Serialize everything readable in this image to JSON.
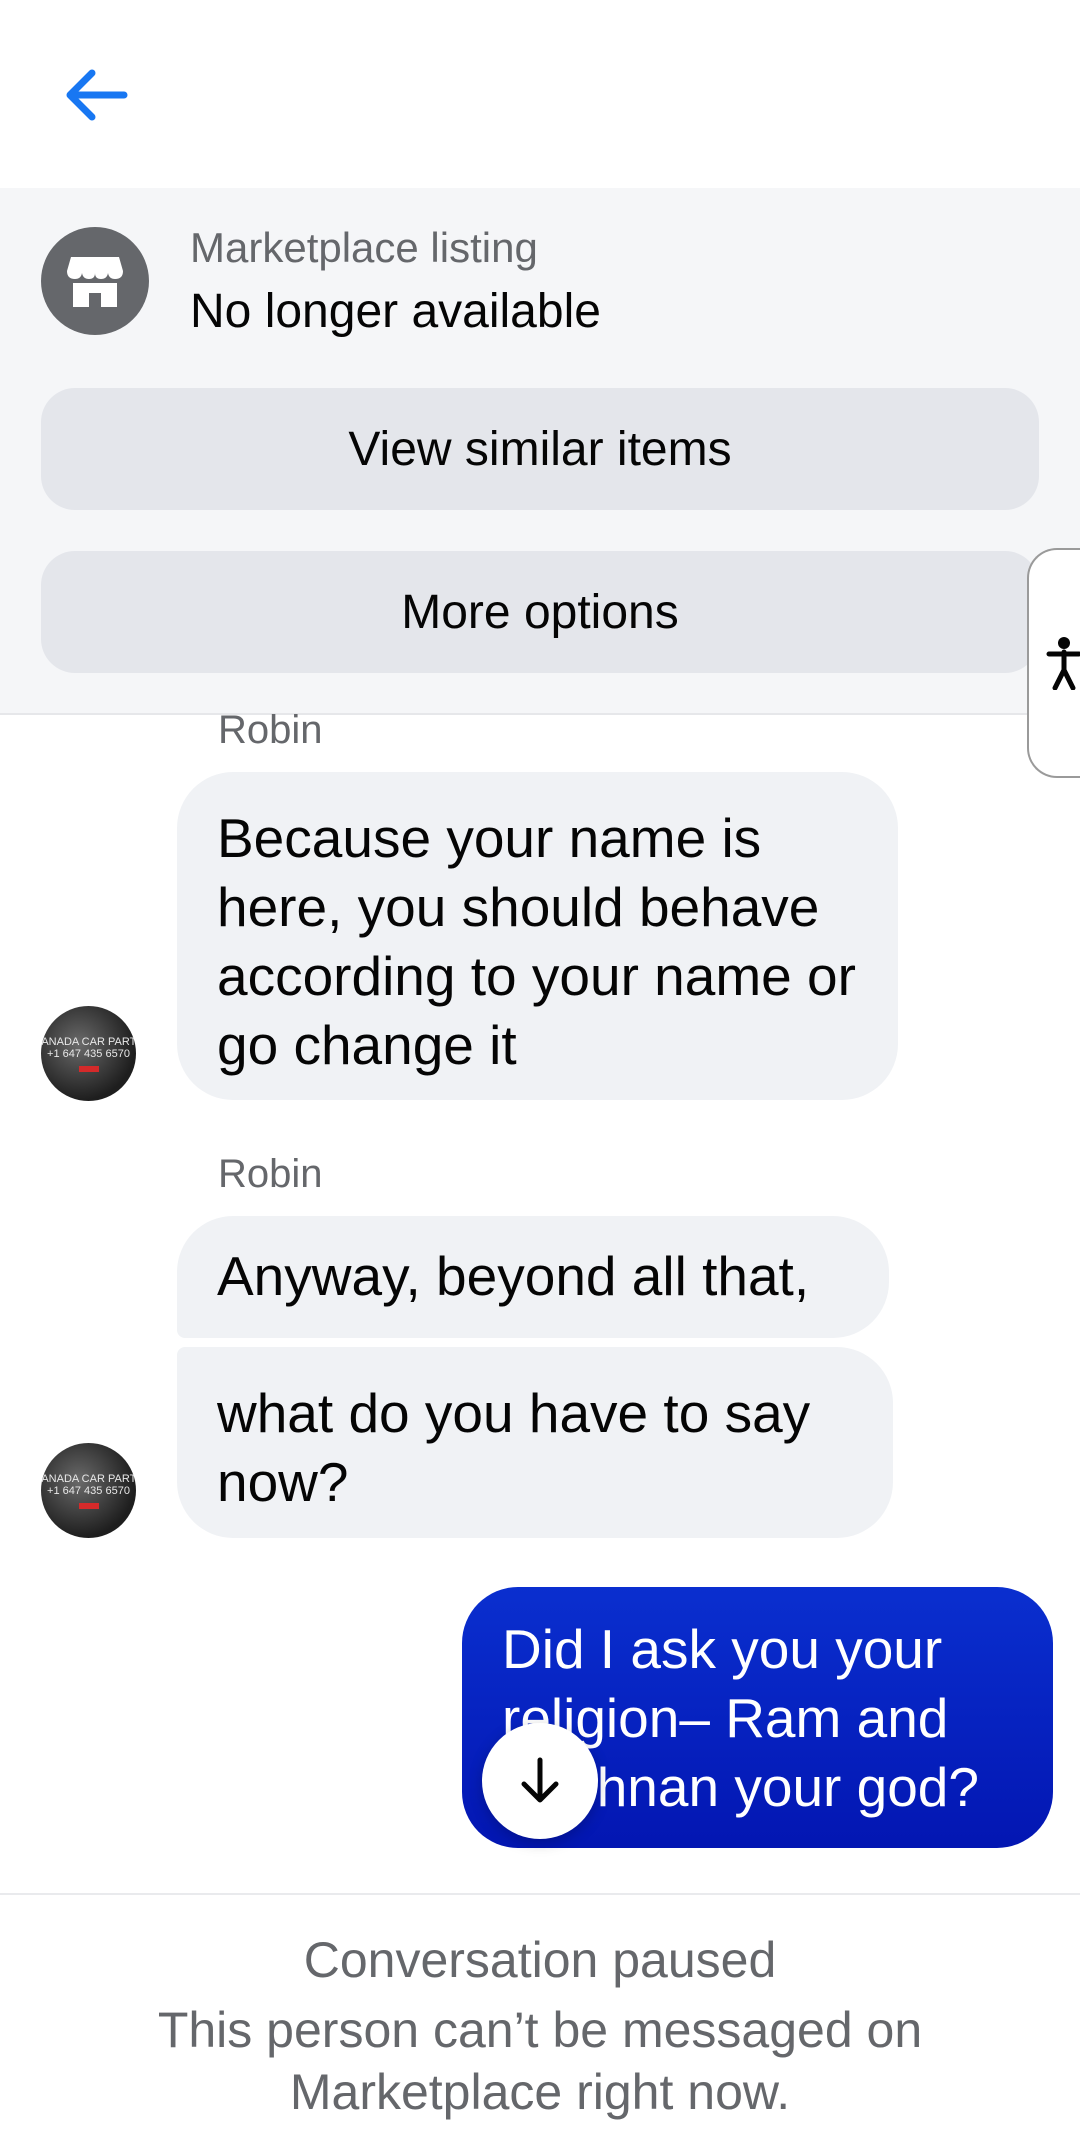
{
  "header": {
    "back_icon": "arrow-left-icon",
    "accent_color": "#1877f2"
  },
  "listing": {
    "icon": "store-icon",
    "label": "Marketplace listing",
    "status": "No longer available",
    "view_similar_label": "View similar items",
    "more_options_label": "More options"
  },
  "accessibility_tab": {
    "icon": "accessibility-icon"
  },
  "messages": [
    {
      "sender": "Robin",
      "bubbles": [
        "Because your name is here, you should behave according to your name or go change it"
      ]
    },
    {
      "sender": "Robin",
      "bubbles": [
        "Anyway, beyond all that,",
        "what do you have to say now?"
      ]
    },
    {
      "sender": "me",
      "bubbles": [
        "Did I ask you your religion– Ram and Krishnan your god?"
      ]
    }
  ],
  "avatar_logo": {
    "line1": "CANADA CAR PARTS",
    "line2": "+1 647 435 6570"
  },
  "outgoing_color": "#0a1fc4",
  "scroll_button": {
    "icon": "arrow-down-icon"
  },
  "footer": {
    "title": "Conversation paused",
    "description": "This person can’t be messaged on Marketplace right now."
  }
}
